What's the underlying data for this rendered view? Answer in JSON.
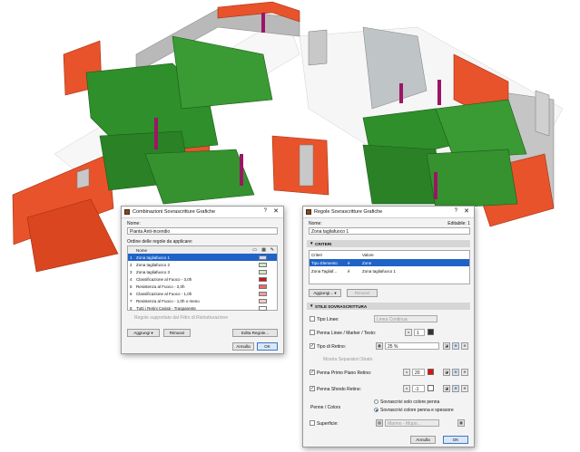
{
  "colors": {
    "wall_orange": "#e8532b",
    "wall_grey": "#b9b9b9",
    "wall_green": "#2f8f2a",
    "column_magenta": "#9c1565",
    "selection": "#1f62c8"
  },
  "combinazioni": {
    "title": "Combinazioni Sovrascritture Grafiche",
    "help": "?",
    "close": "✕",
    "nome_label": "Nome:",
    "nome_value": "Pianta Anti-incendio",
    "ordine_label": "Ordine delle regole da applicare:",
    "col_nome": "Nome",
    "rules": [
      {
        "num": "1",
        "name": "Zona tagliafuoco 1",
        "swatch": "#cfd8ff"
      },
      {
        "num": "2",
        "name": "Zona tagliafuoco 2",
        "swatch": "#cfe8c8"
      },
      {
        "num": "3",
        "name": "Zona tagliafuoco 3",
        "swatch": "#cfe8c8"
      },
      {
        "num": "4",
        "name": "Classificazione al Fuoco - 3,0h",
        "swatch": "#c81818"
      },
      {
        "num": "5",
        "name": "Resistenza al Fuoco - 2,0h",
        "swatch": "#e86a6a"
      },
      {
        "num": "6",
        "name": "Classificazione al Fuoco - 1,0h",
        "swatch": "#f0a0a0"
      },
      {
        "num": "7",
        "name": "Resistenza al Fuoco - 1,0h o meno",
        "swatch": "#f4c8c8"
      },
      {
        "num": "8",
        "name": "Tutti i Retini Cariati - Trasparente",
        "swatch": "#ffffff"
      }
    ],
    "hint": "Regole supportate dal Filtro di Ristrutturazione",
    "add": "Aggiungi",
    "remove": "Rimuovi",
    "edit_rules": "Edita Regole...",
    "cancel": "Annulla",
    "ok": "OK"
  },
  "regole": {
    "title": "Regole Sovrascritture Grafiche",
    "help": "?",
    "close": "✕",
    "nome_label": "Nome:",
    "editable": "Editabile: 1",
    "nome_value": "Zona tagliafuoco 1",
    "criteri_header": "CRITERI",
    "col_criteri": "Criteri",
    "col_valore": "Valore",
    "criteri": [
      {
        "criterio": "Tipo Elemento",
        "op": "è",
        "valore": "Zone"
      },
      {
        "criterio": "Zona Tagliaf...",
        "op": "è",
        "valore": "Zona tagliafuoco 1"
      }
    ],
    "add": "Aggiungi...",
    "remove": "Rimuovi",
    "stile_header": "STILE SOVRASCRITTURA",
    "tipo_linee": "Tipo Linee:",
    "tipo_linee_value": "Linea Continua",
    "penna_linee": "Penna Linee / Marker / Testo:",
    "penna_linee_num": "1",
    "tipo_retino": "Tipo di Retino:",
    "tipo_retino_value": "25 %",
    "mostra_sep": "Mostra Separatori Strato",
    "penna_primo": "Penna Primo Piano Retino:",
    "penna_primo_num": "20",
    "penna_sfondo": "Penna Sfondo Retino:",
    "penna_sfondo_num": "-1",
    "penne_colors": "Penne / Colors",
    "radio1": "Sovrascrivi solo colore penna",
    "radio2": "Sovrascrivi colore penna e spessore",
    "superficie": "Superficie:",
    "superficie_value": "Marmo - Mupo...",
    "cancel": "Annulla",
    "ok": "OK"
  }
}
